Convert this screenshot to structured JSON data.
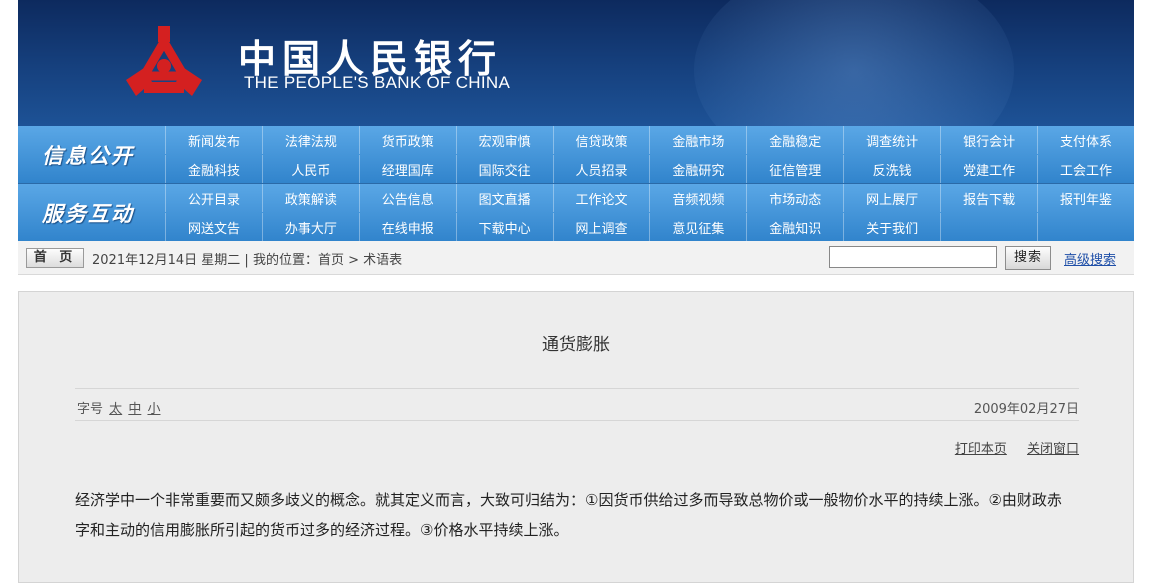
{
  "site": {
    "title_cn": "中国人民银行",
    "title_en": "THE PEOPLE'S BANK OF CHINA",
    "logo_icon": "pboc-emblem-icon",
    "colors": {
      "banner": "#16417f",
      "nav": "#3f8fd4",
      "emblem": "#d42020"
    }
  },
  "nav": {
    "groups": [
      {
        "heading": "信息公开",
        "items": [
          "新闻发布",
          "法律法规",
          "货币政策",
          "宏观审慎",
          "信贷政策",
          "金融市场",
          "金融稳定",
          "调查统计",
          "银行会计",
          "支付体系",
          "金融科技",
          "人民币",
          "经理国库",
          "国际交往",
          "人员招录",
          "金融研究",
          "征信管理",
          "反洗钱",
          "党建工作",
          "工会工作"
        ]
      },
      {
        "heading": "服务互动",
        "items": [
          "公开目录",
          "政策解读",
          "公告信息",
          "图文直播",
          "工作论文",
          "音频视频",
          "市场动态",
          "网上展厅",
          "报告下载",
          "报刊年鉴",
          "网送文告",
          "办事大厅",
          "在线申报",
          "下载中心",
          "网上调查",
          "意见征集",
          "金融知识",
          "关于我们",
          "",
          ""
        ]
      }
    ]
  },
  "bar": {
    "home_label": "首 页",
    "location_text": "2021年12月14日 星期二 | 我的位置：首页 > 术语表",
    "search_placeholder": "",
    "search_button": "搜索",
    "advanced_search": "高级搜索"
  },
  "article": {
    "title": "通货膨胀",
    "font_size_label": "字号",
    "font_sizes": [
      "太",
      "中",
      "小"
    ],
    "date": "2009年02月27日",
    "print_label": "打印本页",
    "close_label": "关闭窗口",
    "body": "经济学中一个非常重要而又颇多歧义的概念。就其定义而言，大致可归结为：①因货币供给过多而导致总物价或一般物价水平的持续上涨。②由财政赤字和主动的信用膨胀所引起的货币过多的经济过程。③价格水平持续上涨。"
  }
}
